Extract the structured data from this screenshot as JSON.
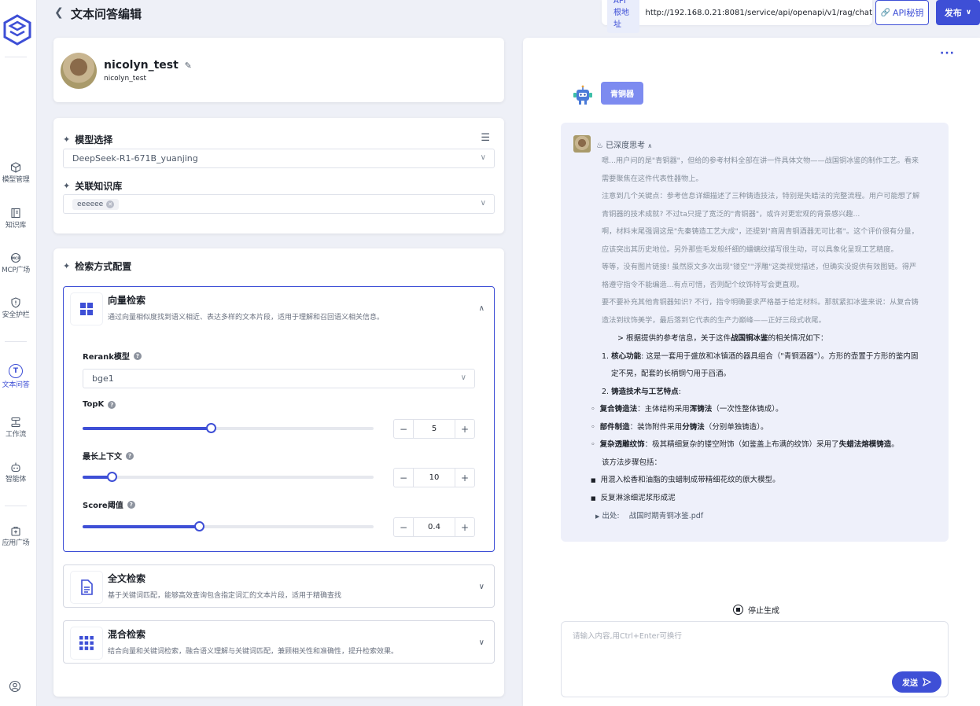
{
  "header": {
    "back_icon": "chevron-left-icon",
    "title": "文本问答编辑",
    "api_tag": "API根地址",
    "api_url": "http://192.168.0.21:8081/service/api/openapi/v1/rag/chat",
    "secret_label": "API秘钥",
    "publish_label": "发布"
  },
  "sidebar": {
    "items": [
      {
        "label": "模型管理",
        "icon": "cube-icon"
      },
      {
        "label": "知识库",
        "icon": "book-icon"
      },
      {
        "label": "MCP广场",
        "icon": "mcp-icon"
      },
      {
        "label": "安全护栏",
        "icon": "shield-icon"
      },
      {
        "label": "文本问答",
        "icon": "text-qa-icon"
      },
      {
        "label": "工作流",
        "icon": "workflow-icon"
      },
      {
        "label": "智能体",
        "icon": "agent-icon"
      },
      {
        "label": "应用广场",
        "icon": "app-store-icon"
      }
    ]
  },
  "profile": {
    "name": "nicolyn_test",
    "subtitle": "nicolyn_test"
  },
  "model": {
    "title": "模型选择",
    "value": "DeepSeek-R1-671B_yuanjing",
    "kb_title": "关联知识库",
    "kb_chip": "eeeeee"
  },
  "retrieval": {
    "title": "检索方式配置",
    "vector": {
      "title": "向量检索",
      "desc": "通过向量相似度找到语义相近、表达多样的文本片段，适用于理解和召回语义相关信息。",
      "rerank_label": "Rerank模型",
      "rerank_value": "bge1",
      "topk_label": "TopK",
      "topk_value": "5",
      "topk_fraction": 0.44,
      "context_label": "最长上下文",
      "context_value": "10",
      "context_fraction": 0.1,
      "score_label": "Score阈值",
      "score_value": "0.4",
      "score_fraction": 0.4
    },
    "fulltext": {
      "title": "全文检索",
      "desc": "基于关键词匹配，能够高效查询包含指定词汇的文本片段，适用于精确查找"
    },
    "hybrid": {
      "title": "混合检索",
      "desc": "结合向量和关键词检索，融合语义理解与关键词匹配，兼顾相关性和准确性，提升检索效果。"
    }
  },
  "chat": {
    "more_icon": "more-dots-icon",
    "question": "青铜器",
    "think_header": "已深度思考",
    "think": [
      "嗯...用户问的是\"青铜器\"，但给的参考材料全部在讲一件具体文物——战国铜冰鉴的制作工艺。看来",
      "需要聚焦在这件代表性器物上。",
      "注意到几个关键点：参考信息详细描述了三种铸造技法，特别是失蜡法的完整流程。用户可能想了解",
      "青铜器的技术成就? 不过ta只提了宽泛的\"青铜器\"，或许对更宏观的背景感兴趣...",
      "啊，材料末尾强调这是\"先秦铸造工艺大成\"，还提到\"商周青铜酒器无可比者\"。这个评价很有分量，",
      "应该突出其历史地位。另外那些毛发般纤细的蟠螭纹描写很生动，可以具象化呈现工艺精度。",
      "等等，没有图片链接! 虽然原文多次出现\"镂空\"\"浮雕\"这类视觉描述，但确实没提供有效图链。得严",
      "格遵守指令不能编造...有点可惜，否则配个纹饰特写会更直观。",
      "要不要补充其他青铜器知识? 不行，指令明确要求严格基于给定材料。那就紧扣冰鉴来说：从复合铸",
      "造法到纹饰美学，最后落到它代表的生产力巅峰——正好三段式收尾。"
    ],
    "answer_intro_pre": "> 根据提供的参考信息，关于这件",
    "answer_intro_bold": "战国铜冰鉴",
    "answer_intro_post": "的相关情况如下：",
    "item1_num": "1.",
    "item1_bold": "核心功能",
    "item1_text": ": 这是一套用于盛放和冰镇酒的器具组合（\"青铜酒器\"）。方形的壶置于方形的鉴内固",
    "item1_text2": "定不晃，配套的长柄铜勺用于舀酒。",
    "item2_num": "2.",
    "item2_bold": "铸造技术与工艺特点",
    "item2_text": ":",
    "sub1_bold": "复合铸造法",
    "sub1_text": "：主体结构采用",
    "sub1_bold2": "浑铸法",
    "sub1_text2": "（一次性整体铸成）。",
    "sub2_bold": "部件制造",
    "sub2_text": "：装饰附件采用",
    "sub2_bold2": "分铸法",
    "sub2_text2": "（分别单独铸造）。",
    "sub3_bold": "复杂透雕纹饰",
    "sub3_text": "：极其精细复杂的镂空附饰（如鉴盖上布满的纹饰）采用了",
    "sub3_bold2": "失蜡法熔模铸造",
    "sub3_text2": "。",
    "sub3_text3": "该方法步骤包括：",
    "step1": "用混入松香和油脂的虫蜡制成带精细花纹的原大模型。",
    "step2": "反复淋涂细泥浆形成泥",
    "source_label": "出处:",
    "source_value": "战国时期青铜冰鉴.pdf",
    "stop_label": "停止生成",
    "input_placeholder": "请输入内容,用Ctrl+Enter可换行",
    "send_label": "发送"
  }
}
